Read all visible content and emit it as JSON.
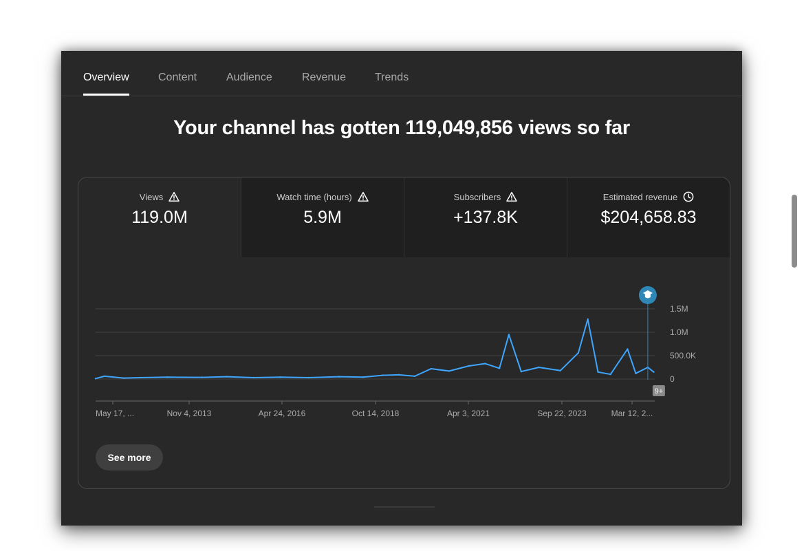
{
  "tabs": [
    {
      "label": "Overview",
      "active": true
    },
    {
      "label": "Content",
      "active": false
    },
    {
      "label": "Audience",
      "active": false
    },
    {
      "label": "Revenue",
      "active": false
    },
    {
      "label": "Trends",
      "active": false
    }
  ],
  "headline": "Your channel has gotten 119,049,856 views so far",
  "metrics": [
    {
      "label": "Views",
      "value": "119.0M",
      "icon": "warning-icon"
    },
    {
      "label": "Watch time (hours)",
      "value": "5.9M",
      "icon": "warning-icon"
    },
    {
      "label": "Subscribers",
      "value": "+137.8K",
      "icon": "warning-icon"
    },
    {
      "label": "Estimated revenue",
      "value": "$204,658.83",
      "icon": "clock-icon"
    }
  ],
  "chart_data": {
    "type": "line",
    "series": [
      {
        "color": "#3ea6ff",
        "x": [
          "2011-05-17",
          "2011-08-01",
          "2012-01-10",
          "2012-06-01",
          "2013-01-15",
          "2013-11-04",
          "2014-06-01",
          "2015-01-15",
          "2015-09-01",
          "2016-04-24",
          "2017-01-10",
          "2017-08-01",
          "2018-01-15",
          "2018-06-01",
          "2018-10-14",
          "2019-03-01",
          "2019-08-01",
          "2020-01-15",
          "2020-06-01",
          "2020-10-01",
          "2020-12-20",
          "2021-04-03",
          "2021-09-01",
          "2022-03-01",
          "2022-08-01",
          "2022-10-20",
          "2023-01-15",
          "2023-05-01",
          "2023-09-22",
          "2023-12-01",
          "2024-03-12",
          "2024-05-01"
        ],
        "y": [
          10000,
          60000,
          20000,
          30000,
          40000,
          35000,
          50000,
          30000,
          40000,
          30000,
          50000,
          40000,
          80000,
          90000,
          60000,
          220000,
          170000,
          280000,
          330000,
          230000,
          950000,
          160000,
          250000,
          180000,
          560000,
          1280000,
          150000,
          100000,
          640000,
          120000,
          250000,
          150000
        ]
      }
    ],
    "x_tick_labels": [
      "May 17, ...",
      "Nov 4, 2013",
      "Apr 24, 2016",
      "Oct 14, 2018",
      "Apr 3, 2021",
      "Sep 22, 2023",
      "Mar 12, 2..."
    ],
    "y_tick_labels": [
      "1.5M",
      "1.0M",
      "500.0K",
      "0"
    ],
    "y_ticks": [
      1500000,
      1000000,
      500000,
      0
    ],
    "ylim": [
      0,
      1500000
    ],
    "grid": true,
    "annotation_marker": {
      "x": "2024-03-12",
      "icon": "graduation-cap-icon"
    },
    "badge": "9+"
  },
  "see_more_label": "See more",
  "colors": {
    "panel_bg": "#282828",
    "accent": "#3ea6ff",
    "marker": "#2f87b6"
  }
}
